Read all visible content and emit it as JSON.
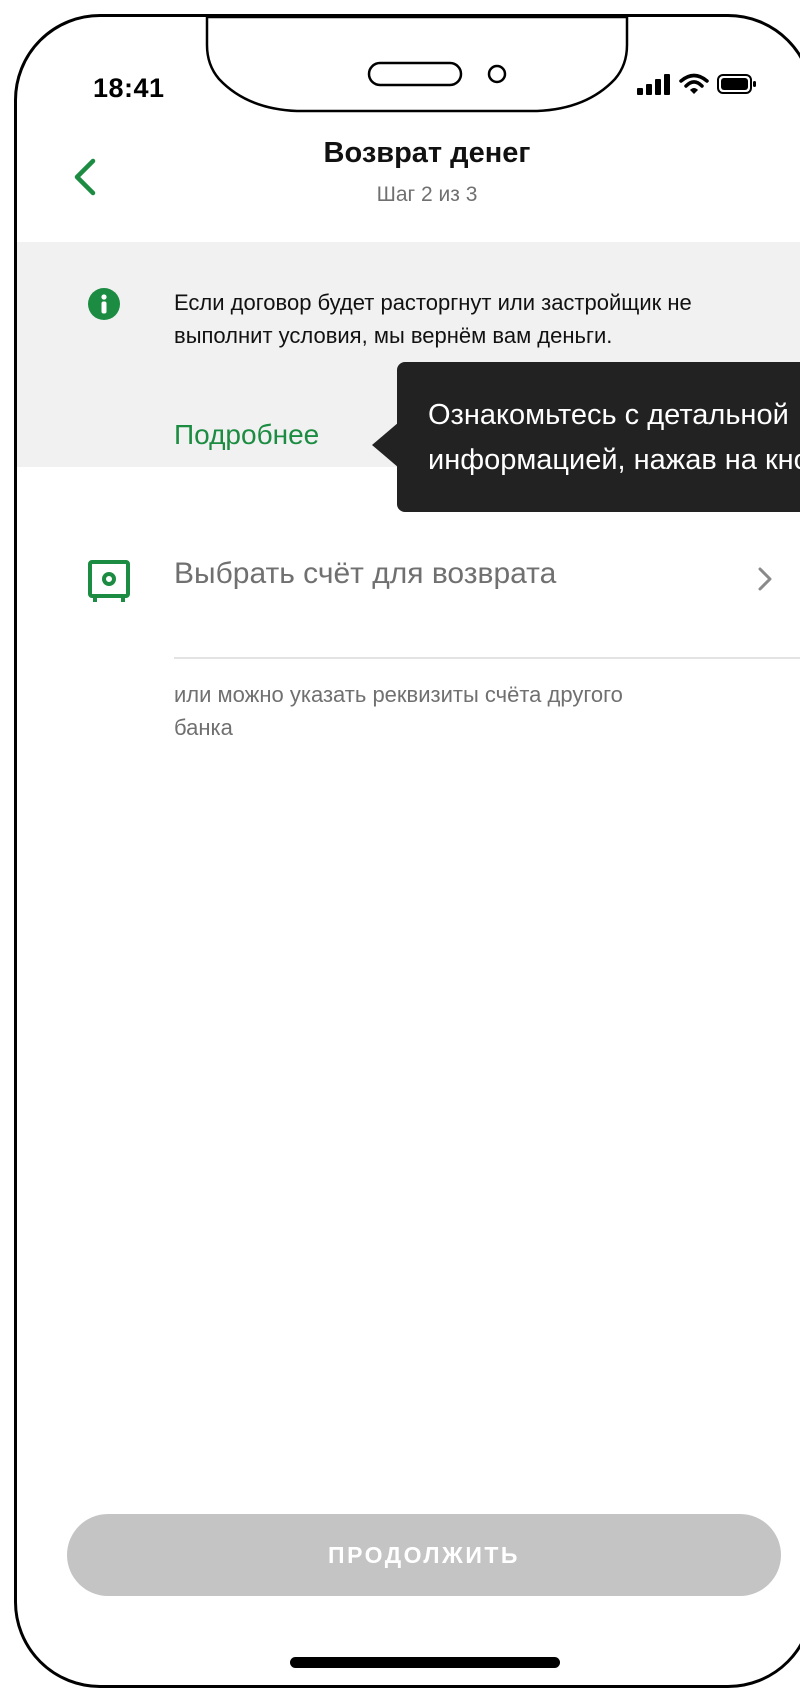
{
  "status_bar": {
    "time": "18:41",
    "icons": [
      "signal-icon",
      "wifi-icon",
      "battery-icon"
    ]
  },
  "header": {
    "back_icon": "chevron-left-icon",
    "title": "Возврат денег",
    "subtitle": "Шаг 2 из 3"
  },
  "info": {
    "icon": "info-icon",
    "text": "Если договор будет расторгнут или застройщик не выполнит условия, мы вернём вам деньги.",
    "link_label": "Подробнее"
  },
  "tooltip": {
    "line1": "Ознакомьтесь с детальной",
    "line2": "информацией, нажав на кнопку"
  },
  "account": {
    "icon": "safe-icon",
    "label": "Выбрать счёт для возврата",
    "chevron": "chevron-right-icon"
  },
  "hint": {
    "text": "или можно указать реквизиты счёта другого банка"
  },
  "footer": {
    "continue_label": "ПРОДОЛЖИТЬ"
  },
  "colors": {
    "accent": "#1c8c42",
    "tooltip_bg": "#222222",
    "panel_bg": "#f1f1f1",
    "button_disabled": "#c4c4c4",
    "secondary_text": "#707070"
  }
}
